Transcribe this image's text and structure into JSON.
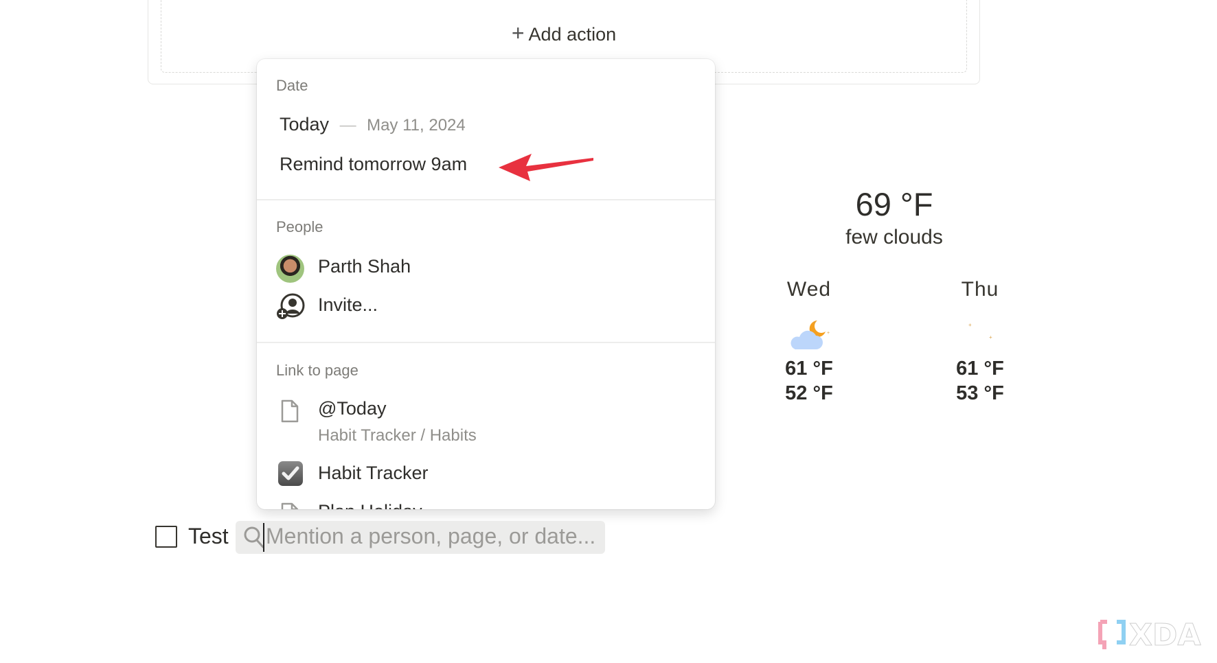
{
  "card": {
    "add_action_label": "Add action"
  },
  "menu": {
    "date": {
      "label": "Date",
      "today_label": "Today",
      "dash": "—",
      "today_date": "May 11, 2024",
      "remind_label": "Remind tomorrow 9am"
    },
    "people": {
      "label": "People",
      "person_name": "Parth Shah",
      "invite_label": "Invite..."
    },
    "link_to_page": {
      "label": "Link to page",
      "items": [
        {
          "title": "@Today",
          "path": "Habit Tracker / Habits",
          "icon": "page-icon"
        },
        {
          "title": "Habit Tracker",
          "icon": "checkbox-checked-icon"
        },
        {
          "title": "Plan Holiday",
          "icon": "page-icon"
        }
      ]
    }
  },
  "annotation": {
    "arrow_color": "#e8313f"
  },
  "weather": {
    "current_temp": "69 °F",
    "condition": "few clouds",
    "forecast": [
      {
        "day": "Wed",
        "icon": "partly-cloudy-night-icon",
        "high": "61 °F",
        "low": "52 °F"
      },
      {
        "day": "Thu",
        "icon": "clear-night-icon",
        "high": "61 °F",
        "low": "53 °F"
      }
    ]
  },
  "todo": {
    "label": "Test",
    "checked": false,
    "search_placeholder": "Mention a person, page, or date..."
  },
  "watermark": {
    "text": "XDA"
  }
}
